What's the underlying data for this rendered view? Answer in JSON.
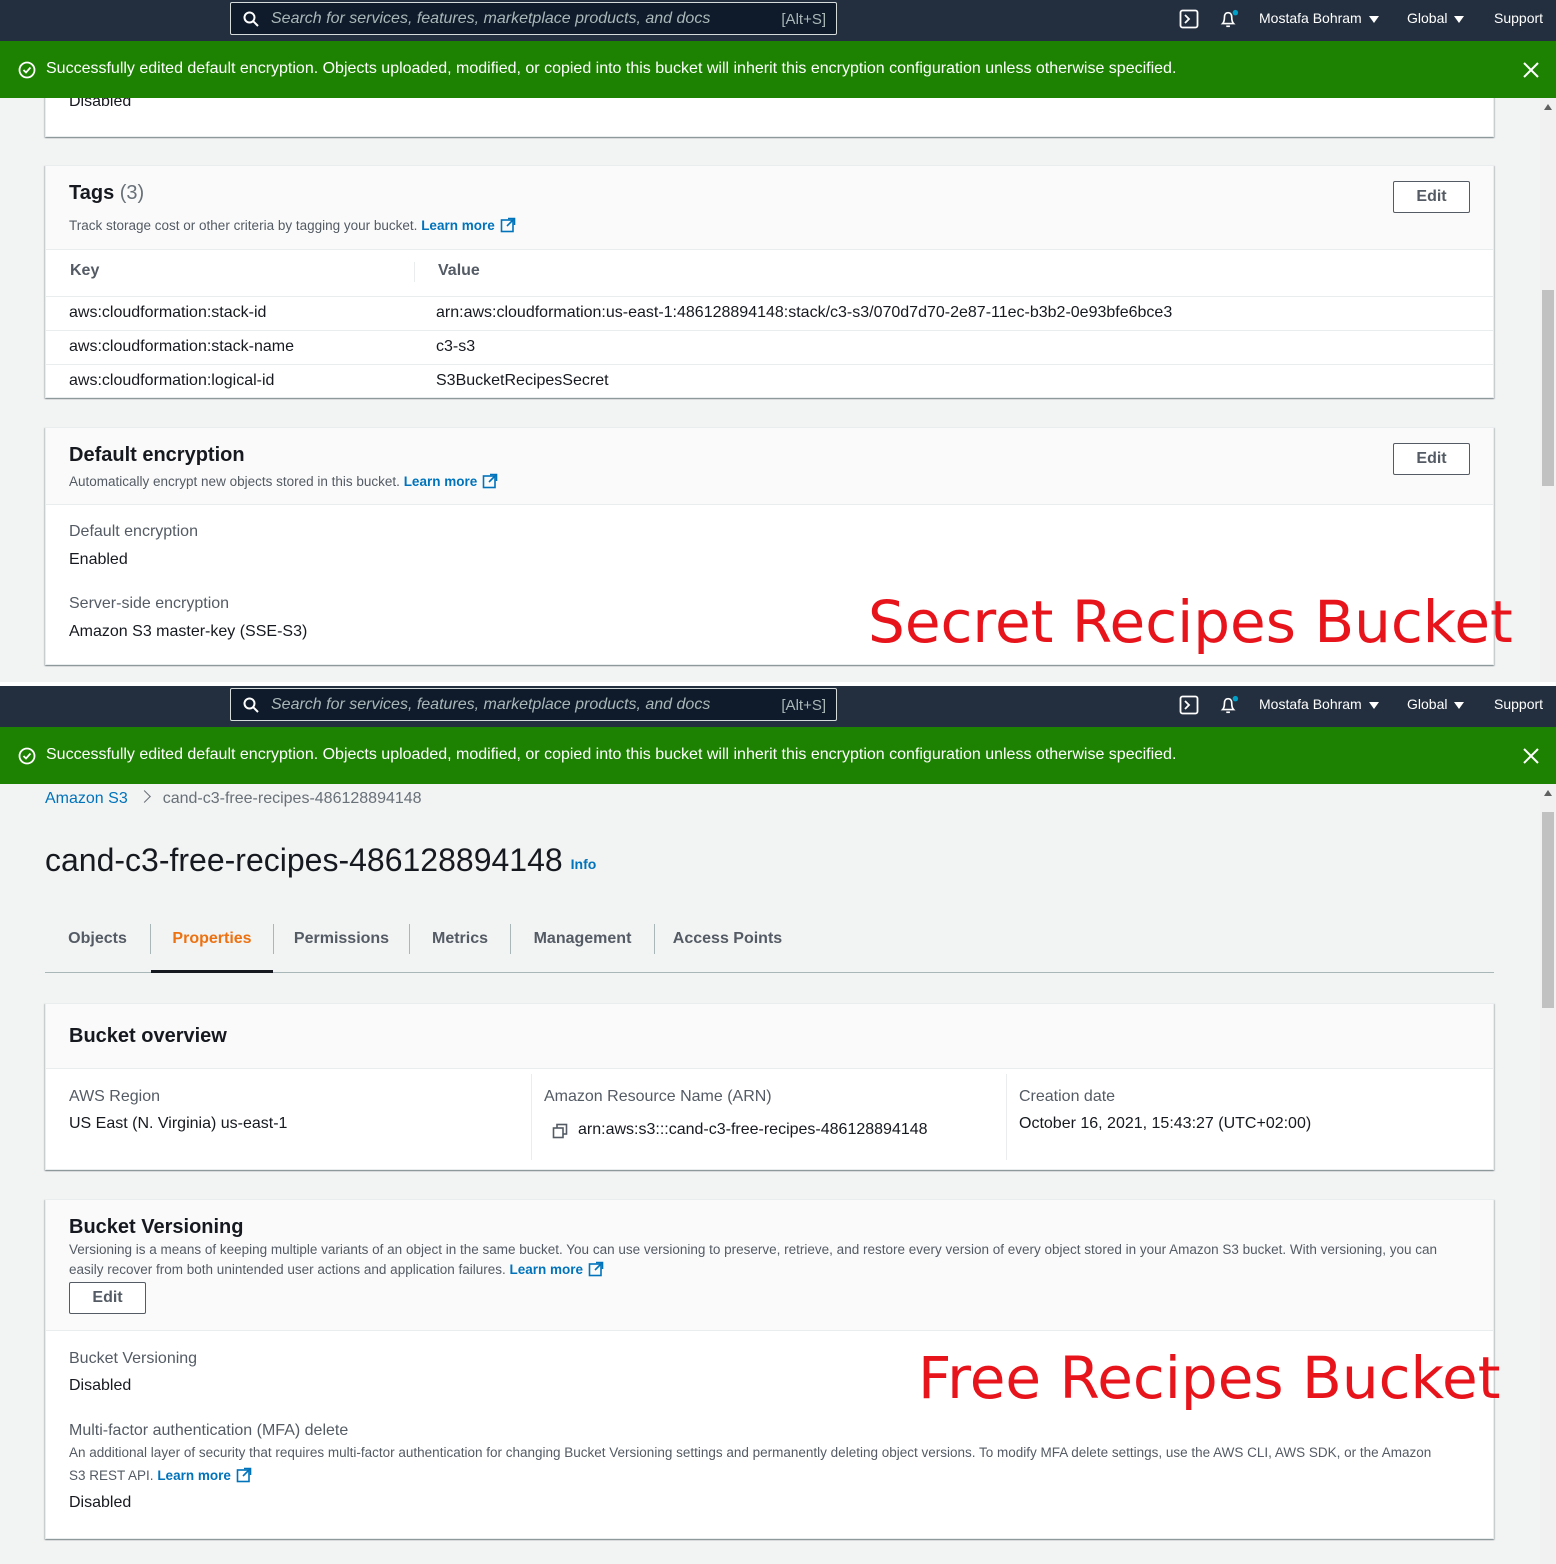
{
  "topbar": {
    "search_placeholder": "Search for services, features, marketplace products, and docs",
    "search_shortcut": "[Alt+S]",
    "user": "Mostafa Bohram",
    "region": "Global",
    "support": "Support"
  },
  "flash": {
    "message": "Successfully edited default encryption. Objects uploaded, modified, or copied into this bucket will inherit this encryption configuration unless otherwise specified."
  },
  "screen1": {
    "top_fragment": "Disabled",
    "tags": {
      "title": "Tags",
      "count": "(3)",
      "description": "Track storage cost or other criteria by tagging your bucket.",
      "learn_more": "Learn more",
      "edit": "Edit",
      "col_key": "Key",
      "col_value": "Value",
      "rows": [
        {
          "key": "aws:cloudformation:stack-id",
          "value": "arn:aws:cloudformation:us-east-1:486128894148:stack/c3-s3/070d7d70-2e87-11ec-b3b2-0e93bfe6bce3"
        },
        {
          "key": "aws:cloudformation:stack-name",
          "value": "c3-s3"
        },
        {
          "key": "aws:cloudformation:logical-id",
          "value": "S3BucketRecipesSecret"
        }
      ]
    },
    "encryption": {
      "title": "Default encryption",
      "description": "Automatically encrypt new objects stored in this bucket.",
      "learn_more": "Learn more",
      "edit": "Edit",
      "default_label": "Default encryption",
      "default_value": "Enabled",
      "sse_label": "Server-side encryption",
      "sse_value": "Amazon S3 master-key (SSE-S3)"
    },
    "annotation": "Secret Recipes Bucket"
  },
  "screen2": {
    "breadcrumb": {
      "root": "Amazon S3",
      "current": "cand-c3-free-recipes-486128894148"
    },
    "title": "cand-c3-free-recipes-486128894148",
    "info": "Info",
    "tabs": [
      "Objects",
      "Properties",
      "Permissions",
      "Metrics",
      "Management",
      "Access Points"
    ],
    "active_tab": "Properties",
    "overview": {
      "title": "Bucket overview",
      "region_label": "AWS Region",
      "region_value": "US East (N. Virginia) us-east-1",
      "arn_label": "Amazon Resource Name (ARN)",
      "arn_value": "arn:aws:s3:::cand-c3-free-recipes-486128894148",
      "date_label": "Creation date",
      "date_value": "October 16, 2021, 15:43:27 (UTC+02:00)"
    },
    "versioning": {
      "title": "Bucket Versioning",
      "description_line1": "Versioning is a means of keeping multiple variants of an object in the same bucket. You can use versioning to preserve, retrieve, and restore every version of every object stored in your Amazon S3 bucket. With versioning, you can",
      "description_line2": "easily recover from both unintended user actions and application failures.",
      "learn_more": "Learn more",
      "edit": "Edit",
      "status_label": "Bucket Versioning",
      "status_value": "Disabled",
      "mfa_label": "Multi-factor authentication (MFA) delete",
      "mfa_desc_line1": "An additional layer of security that requires multi-factor authentication for changing Bucket Versioning settings and permanently deleting object versions. To modify MFA delete settings, use the AWS CLI, AWS SDK, or the Amazon",
      "mfa_desc_line2": "S3 REST API.",
      "mfa_learn_more": "Learn more",
      "mfa_value": "Disabled"
    },
    "annotation": "Free Recipes Bucket"
  },
  "colors": {
    "topbar": "#232f3e",
    "flash_success": "#1d8102",
    "link": "#0073bb",
    "active_tab": "#ec7211",
    "annotation": "#e8141c"
  },
  "icons": [
    "search-icon",
    "cloudshell-icon",
    "bell-icon",
    "success-check-icon",
    "close-icon",
    "external-link-icon",
    "copy-icon"
  ]
}
